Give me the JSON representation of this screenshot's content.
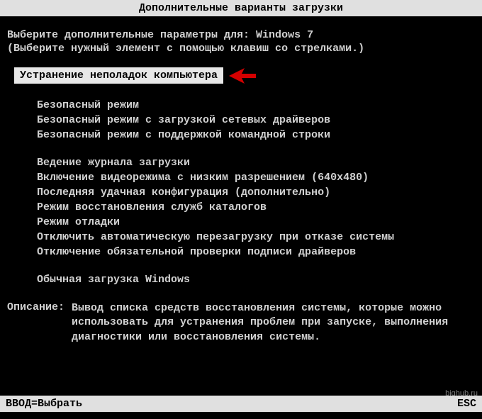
{
  "title": "Дополнительные варианты загрузки",
  "prompt": "Выберите дополнительные параметры для: Windows 7",
  "hint": "(Выберите нужный элемент с помощью клавиш со стрелками.)",
  "selected": "Устранение неполадок компьютера",
  "group1": {
    "item0": "Безопасный режим",
    "item1": "Безопасный режим с загрузкой сетевых драйверов",
    "item2": "Безопасный режим с поддержкой командной строки"
  },
  "group2": {
    "item0": "Ведение журнала загрузки",
    "item1": "Включение видеорежима с низким разрешением (640x480)",
    "item2": "Последняя удачная конфигурация (дополнительно)",
    "item3": "Режим восстановления служб каталогов",
    "item4": "Режим отладки",
    "item5": "Отключить автоматическую перезагрузку при отказе системы",
    "item6": "Отключение обязательной проверки подписи драйверов"
  },
  "group3": {
    "item0": "Обычная загрузка Windows"
  },
  "description_label": "Описание:",
  "description_text": "Вывод списка средств восстановления системы, которые можно использовать для устранения проблем при запуске, выполнения диагностики или восстановления системы.",
  "footer_left": "ВВОД=Выбрать",
  "footer_right": "ESC",
  "watermark": "bighub.ru"
}
